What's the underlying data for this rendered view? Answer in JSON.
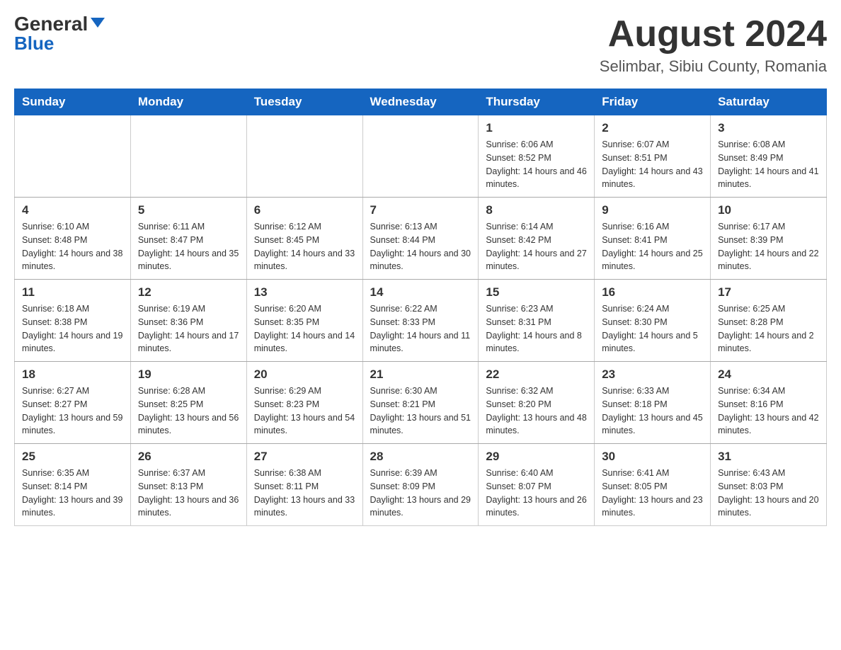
{
  "header": {
    "logo_general": "General",
    "logo_blue": "Blue",
    "title": "August 2024",
    "subtitle": "Selimbar, Sibiu County, Romania"
  },
  "days_of_week": [
    "Sunday",
    "Monday",
    "Tuesday",
    "Wednesday",
    "Thursday",
    "Friday",
    "Saturday"
  ],
  "weeks": [
    [
      {
        "day": "",
        "info": ""
      },
      {
        "day": "",
        "info": ""
      },
      {
        "day": "",
        "info": ""
      },
      {
        "day": "",
        "info": ""
      },
      {
        "day": "1",
        "info": "Sunrise: 6:06 AM\nSunset: 8:52 PM\nDaylight: 14 hours and 46 minutes."
      },
      {
        "day": "2",
        "info": "Sunrise: 6:07 AM\nSunset: 8:51 PM\nDaylight: 14 hours and 43 minutes."
      },
      {
        "day": "3",
        "info": "Sunrise: 6:08 AM\nSunset: 8:49 PM\nDaylight: 14 hours and 41 minutes."
      }
    ],
    [
      {
        "day": "4",
        "info": "Sunrise: 6:10 AM\nSunset: 8:48 PM\nDaylight: 14 hours and 38 minutes."
      },
      {
        "day": "5",
        "info": "Sunrise: 6:11 AM\nSunset: 8:47 PM\nDaylight: 14 hours and 35 minutes."
      },
      {
        "day": "6",
        "info": "Sunrise: 6:12 AM\nSunset: 8:45 PM\nDaylight: 14 hours and 33 minutes."
      },
      {
        "day": "7",
        "info": "Sunrise: 6:13 AM\nSunset: 8:44 PM\nDaylight: 14 hours and 30 minutes."
      },
      {
        "day": "8",
        "info": "Sunrise: 6:14 AM\nSunset: 8:42 PM\nDaylight: 14 hours and 27 minutes."
      },
      {
        "day": "9",
        "info": "Sunrise: 6:16 AM\nSunset: 8:41 PM\nDaylight: 14 hours and 25 minutes."
      },
      {
        "day": "10",
        "info": "Sunrise: 6:17 AM\nSunset: 8:39 PM\nDaylight: 14 hours and 22 minutes."
      }
    ],
    [
      {
        "day": "11",
        "info": "Sunrise: 6:18 AM\nSunset: 8:38 PM\nDaylight: 14 hours and 19 minutes."
      },
      {
        "day": "12",
        "info": "Sunrise: 6:19 AM\nSunset: 8:36 PM\nDaylight: 14 hours and 17 minutes."
      },
      {
        "day": "13",
        "info": "Sunrise: 6:20 AM\nSunset: 8:35 PM\nDaylight: 14 hours and 14 minutes."
      },
      {
        "day": "14",
        "info": "Sunrise: 6:22 AM\nSunset: 8:33 PM\nDaylight: 14 hours and 11 minutes."
      },
      {
        "day": "15",
        "info": "Sunrise: 6:23 AM\nSunset: 8:31 PM\nDaylight: 14 hours and 8 minutes."
      },
      {
        "day": "16",
        "info": "Sunrise: 6:24 AM\nSunset: 8:30 PM\nDaylight: 14 hours and 5 minutes."
      },
      {
        "day": "17",
        "info": "Sunrise: 6:25 AM\nSunset: 8:28 PM\nDaylight: 14 hours and 2 minutes."
      }
    ],
    [
      {
        "day": "18",
        "info": "Sunrise: 6:27 AM\nSunset: 8:27 PM\nDaylight: 13 hours and 59 minutes."
      },
      {
        "day": "19",
        "info": "Sunrise: 6:28 AM\nSunset: 8:25 PM\nDaylight: 13 hours and 56 minutes."
      },
      {
        "day": "20",
        "info": "Sunrise: 6:29 AM\nSunset: 8:23 PM\nDaylight: 13 hours and 54 minutes."
      },
      {
        "day": "21",
        "info": "Sunrise: 6:30 AM\nSunset: 8:21 PM\nDaylight: 13 hours and 51 minutes."
      },
      {
        "day": "22",
        "info": "Sunrise: 6:32 AM\nSunset: 8:20 PM\nDaylight: 13 hours and 48 minutes."
      },
      {
        "day": "23",
        "info": "Sunrise: 6:33 AM\nSunset: 8:18 PM\nDaylight: 13 hours and 45 minutes."
      },
      {
        "day": "24",
        "info": "Sunrise: 6:34 AM\nSunset: 8:16 PM\nDaylight: 13 hours and 42 minutes."
      }
    ],
    [
      {
        "day": "25",
        "info": "Sunrise: 6:35 AM\nSunset: 8:14 PM\nDaylight: 13 hours and 39 minutes."
      },
      {
        "day": "26",
        "info": "Sunrise: 6:37 AM\nSunset: 8:13 PM\nDaylight: 13 hours and 36 minutes."
      },
      {
        "day": "27",
        "info": "Sunrise: 6:38 AM\nSunset: 8:11 PM\nDaylight: 13 hours and 33 minutes."
      },
      {
        "day": "28",
        "info": "Sunrise: 6:39 AM\nSunset: 8:09 PM\nDaylight: 13 hours and 29 minutes."
      },
      {
        "day": "29",
        "info": "Sunrise: 6:40 AM\nSunset: 8:07 PM\nDaylight: 13 hours and 26 minutes."
      },
      {
        "day": "30",
        "info": "Sunrise: 6:41 AM\nSunset: 8:05 PM\nDaylight: 13 hours and 23 minutes."
      },
      {
        "day": "31",
        "info": "Sunrise: 6:43 AM\nSunset: 8:03 PM\nDaylight: 13 hours and 20 minutes."
      }
    ]
  ]
}
